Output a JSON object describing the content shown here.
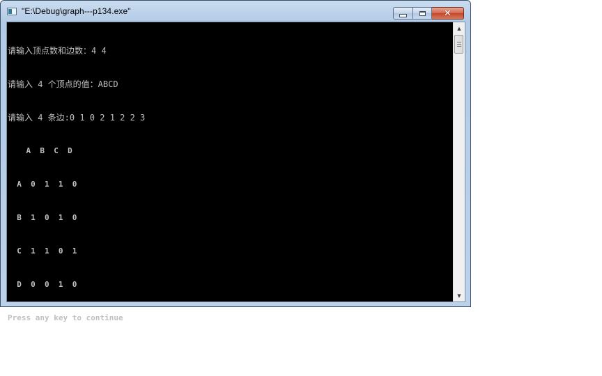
{
  "window": {
    "title": "\"E:\\Debug\\graph---p134.exe\"",
    "buttons": {
      "minimize": "minimize",
      "maximize": "maximize",
      "close": "close"
    }
  },
  "console": {
    "lines": [
      "请输入顶点数和边数：4 4",
      "请输入 4 个顶点的值：ABCD",
      "请输入 4 条边:0 1 0 2 1 2 2 3",
      "    A  B  C  D",
      "  A  0  1  1  0",
      "  B  1  0  1  0",
      "  C  1  1  0  1",
      "  D  0  0  1  0",
      "Press any key to continue"
    ]
  },
  "colors": {
    "console_bg": "#000000",
    "console_fg": "#c0c0c0",
    "close_button": "#c7472b"
  }
}
